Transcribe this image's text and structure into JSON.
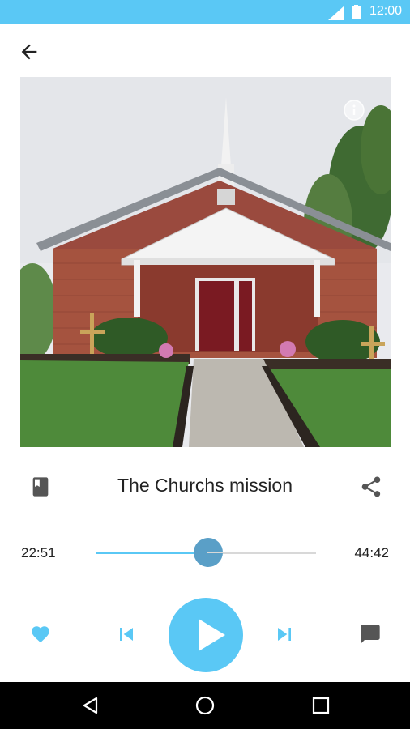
{
  "status_bar": {
    "time": "12:00",
    "icons": [
      "signal-icon",
      "battery-icon"
    ]
  },
  "header": {
    "back_icon": "arrow-back-icon"
  },
  "artwork": {
    "description_icon": "info-icon"
  },
  "track": {
    "title": "The Churchs mission",
    "left_icon": "book-icon",
    "right_icon": "share-icon"
  },
  "progress": {
    "elapsed": "22:51",
    "duration": "44:42",
    "fraction": 0.51
  },
  "controls": [
    "favorite-heart-icon",
    "skip-previous-icon",
    "play-icon",
    "skip-next-icon",
    "comment-icon"
  ],
  "nav_bar": [
    "back-triangle-icon",
    "home-circle-icon",
    "recents-square-icon"
  ],
  "colors": {
    "accent": "#5ac8f5",
    "knob": "#5a9fc7",
    "icon_gray": "#555555"
  }
}
